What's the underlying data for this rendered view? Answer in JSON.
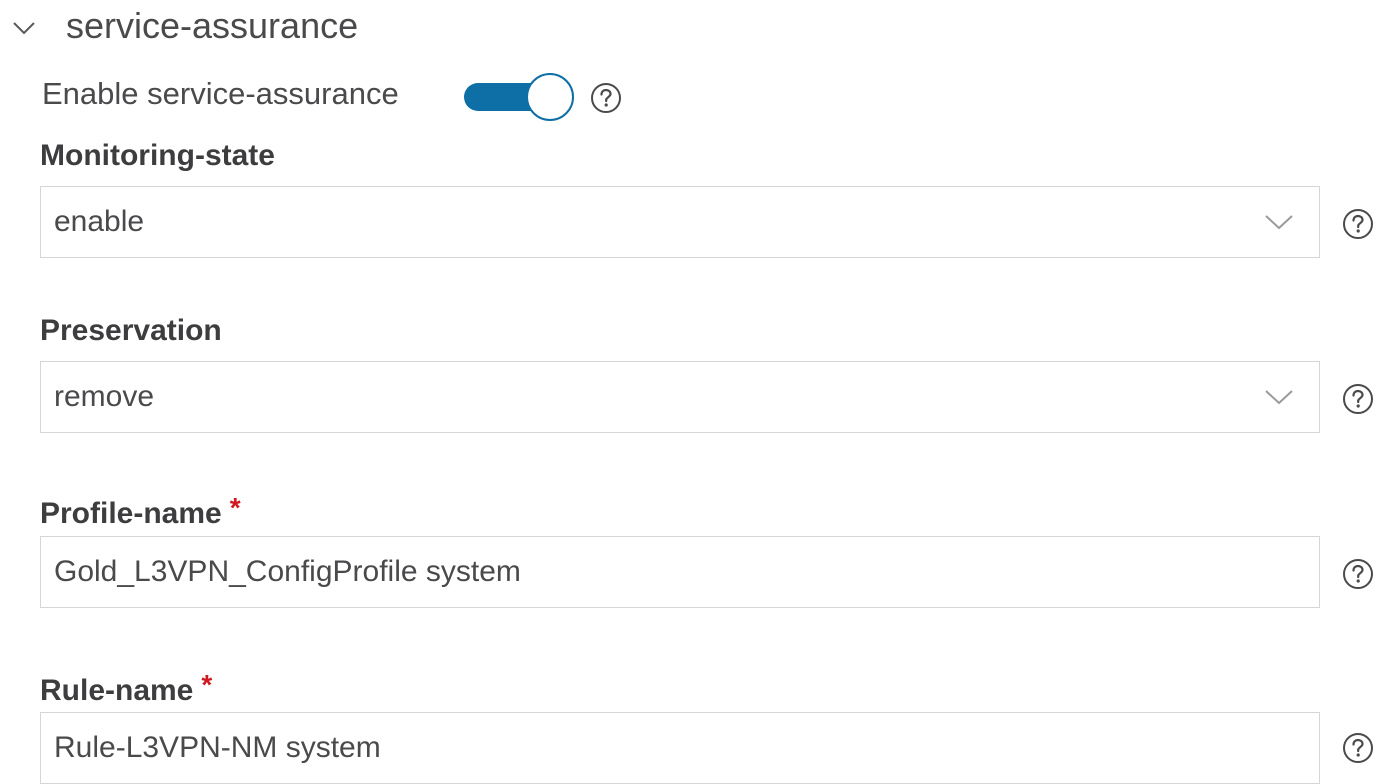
{
  "section": {
    "title": "service-assurance",
    "expanded": true,
    "icon": "chevron-down-icon"
  },
  "toggle": {
    "label": "Enable service-assurance",
    "enabled": true,
    "accent_color": "#0d6fa5"
  },
  "fields": {
    "monitoring_state": {
      "label": "Monitoring-state",
      "value": "enable",
      "type": "select"
    },
    "preservation": {
      "label": "Preservation",
      "value": "remove",
      "type": "select"
    },
    "profile_name": {
      "label": "Profile-name",
      "required_marker": "*",
      "value": "Gold_L3VPN_ConfigProfile system",
      "type": "text"
    },
    "rule_name": {
      "label": "Rule-name",
      "required_marker": "*",
      "value": "Rule-L3VPN-NM system",
      "type": "text"
    }
  },
  "icons": {
    "help": "help-icon",
    "dropdown": "chevron-down-icon"
  },
  "colors": {
    "accent": "#0d6fa5",
    "required": "#d0181e",
    "border": "#d6d6d6"
  }
}
